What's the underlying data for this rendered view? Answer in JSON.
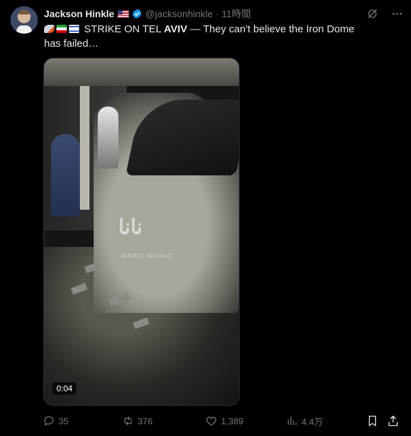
{
  "tweet": {
    "author_name": "Jackson Hinkle",
    "handle": "@jacksonhinkle",
    "separator": "·",
    "time": "11時間",
    "text_main": "STRIKE ON TEL",
    "text_bold": "AVIV",
    "text_rest": "— They can't believe the Iron Dome has failed…"
  },
  "media": {
    "duration": "0:04",
    "watermark_large": "نانا",
    "watermark_small": "MARIO NAHAO"
  },
  "actions": {
    "replies": "35",
    "reposts": "376",
    "likes": "1,389",
    "views": "4.4万"
  },
  "colors": {
    "background": "#000000",
    "text": "#e7e9ea",
    "muted": "#71767b",
    "verified": "#1d9bf0"
  }
}
